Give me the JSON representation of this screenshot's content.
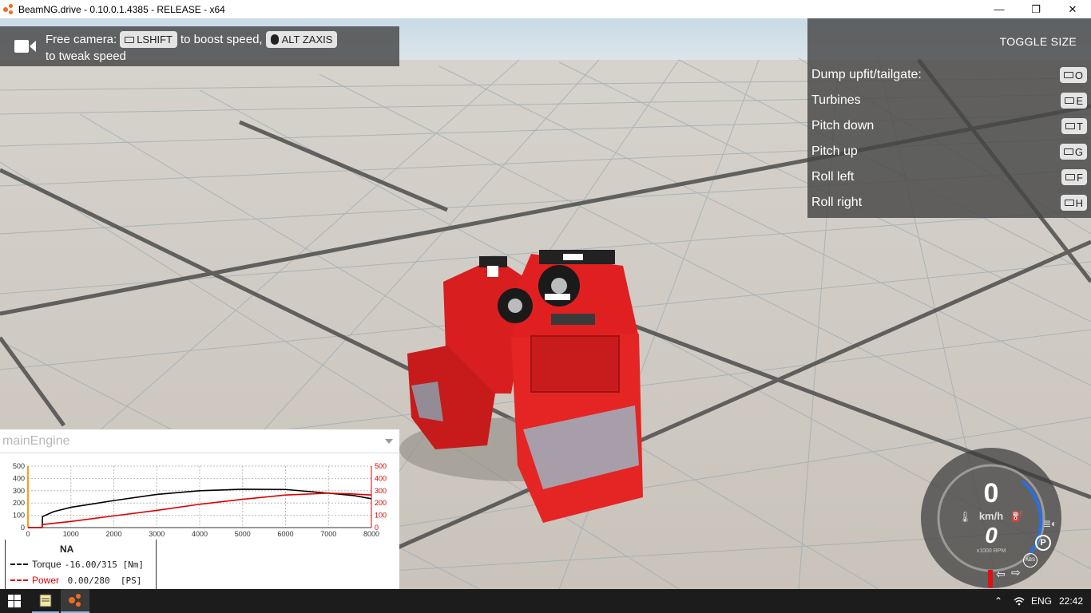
{
  "window": {
    "title": "BeamNG.drive - 0.10.0.1.4385 - RELEASE - x64",
    "minimize_glyph": "—",
    "maximize_glyph": "❐",
    "close_glyph": "✕"
  },
  "camera_hint": {
    "text_prefix": "Free camera:",
    "key1": "LSHIFT",
    "text_mid": "to boost speed,",
    "key2": "ALT ZAXIS",
    "text_suffix": "to tweak speed",
    "icon": "video-camera-icon"
  },
  "bindings": {
    "toggle_label": "TOGGLE SIZE",
    "items": [
      {
        "label": "Dump upfit/tailgate:",
        "key": "O"
      },
      {
        "label": "Turbines",
        "key": "E"
      },
      {
        "label": "Pitch down",
        "key": "T"
      },
      {
        "label": "Pitch up",
        "key": "G"
      },
      {
        "label": "Roll left",
        "key": "F"
      },
      {
        "label": "Roll right",
        "key": "H"
      }
    ]
  },
  "engine_panel": {
    "title": "mainEngine",
    "legend_title": "NA",
    "torque_label": "Torque",
    "torque_value": "-16.00/315 [Nm]",
    "power_label": "Power",
    "power_value": " 0.00/280  [PS]"
  },
  "chart_data": {
    "type": "line",
    "x_ticks": [
      "0",
      "1000",
      "2000",
      "3000",
      "4000",
      "5000",
      "6000",
      "7000",
      "8000"
    ],
    "y_left_ticks": [
      "0",
      "100",
      "200",
      "300",
      "400",
      "500"
    ],
    "y_right_ticks": [
      "0",
      "100",
      "200",
      "300",
      "400",
      "500"
    ],
    "xlim": [
      0,
      8000
    ],
    "ylim": [
      0,
      500
    ],
    "grid": true,
    "series": [
      {
        "name": "Torque",
        "color": "#000000",
        "x": [
          0,
          330,
          340,
          600,
          1000,
          2000,
          3000,
          4000,
          5000,
          6000,
          7000,
          7600,
          8000
        ],
        "y": [
          0,
          0,
          90,
          130,
          165,
          220,
          270,
          300,
          312,
          310,
          280,
          260,
          235
        ]
      },
      {
        "name": "Power",
        "color": "#e00000",
        "x": [
          0,
          330,
          340,
          1000,
          2000,
          3000,
          4000,
          5000,
          6000,
          7000,
          7500,
          8000
        ],
        "y": [
          0,
          0,
          25,
          50,
          95,
          140,
          190,
          230,
          265,
          280,
          275,
          265
        ]
      }
    ]
  },
  "gauge": {
    "speed": "0",
    "speed_unit": "km/h",
    "rpm": "0",
    "rpm_unit": "x1000 RPM",
    "gear_indicator": "P",
    "abs_label": "ABS"
  },
  "taskbar": {
    "language": "ENG",
    "time": "22:42"
  }
}
